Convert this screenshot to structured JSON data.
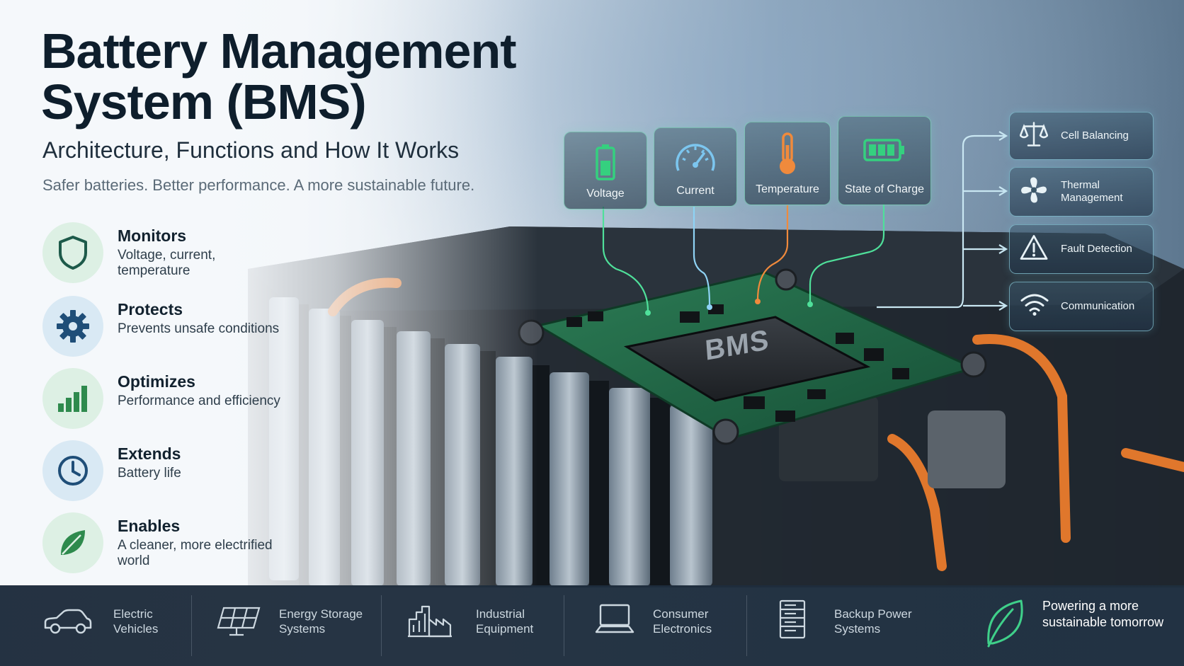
{
  "header": {
    "title": "Battery Management System (BMS)",
    "subtitle": "Architecture, Functions and How It Works",
    "tagline": "Safer batteries. Better performance. A more sustainable future."
  },
  "features": [
    {
      "title": "Monitors",
      "description": "Voltage, current, temperature",
      "icon": "shield-icon"
    },
    {
      "title": "Protects",
      "description": "Prevents unsafe conditions",
      "icon": "gear-icon"
    },
    {
      "title": "Optimizes",
      "description": "Performance and efficiency",
      "icon": "bar-chart-icon"
    },
    {
      "title": "Extends",
      "description": "Battery life",
      "icon": "clock-icon"
    },
    {
      "title": "Enables",
      "description": "A cleaner, more electrified world",
      "icon": "leaf-icon"
    }
  ],
  "sensors": [
    {
      "label": "Voltage",
      "icon": "battery-icon",
      "color": "#35d07f"
    },
    {
      "label": "Current",
      "icon": "gauge-icon",
      "color": "#7cc6ef"
    },
    {
      "label": "Temperature",
      "icon": "thermometer-icon",
      "color": "#f08a3c"
    },
    {
      "label": "State of Charge",
      "icon": "battery-level-icon",
      "color": "#35d07f"
    }
  ],
  "chip": {
    "label": "BMS"
  },
  "functions": [
    {
      "label": "Cell Balancing",
      "icon": "scale-icon"
    },
    {
      "label": "Thermal Management",
      "icon": "fan-icon"
    },
    {
      "label": "Fault Detection",
      "icon": "warning-icon"
    },
    {
      "label": "Communication",
      "icon": "wifi-icon"
    }
  ],
  "applications": [
    {
      "label": "Electric Vehicles",
      "icon": "car-icon"
    },
    {
      "label": "Energy Storage Systems",
      "icon": "solar-panel-icon"
    },
    {
      "label": "Industrial Equipment",
      "icon": "factory-icon"
    },
    {
      "label": "Consumer Electronics",
      "icon": "laptop-icon"
    },
    {
      "label": "Backup Power Systems",
      "icon": "server-rack-icon"
    }
  ],
  "closing": {
    "text": "Powering a more sustainable tomorrow",
    "icon": "leaf-icon"
  },
  "colors": {
    "navy": "#0e1e2c",
    "accent_green": "#2e8a4d",
    "accent_blue": "#1e5f86",
    "wire_orange": "#e0772c",
    "pcb_green": "#1f6b47",
    "bar_bg": "#1c2a3a"
  }
}
